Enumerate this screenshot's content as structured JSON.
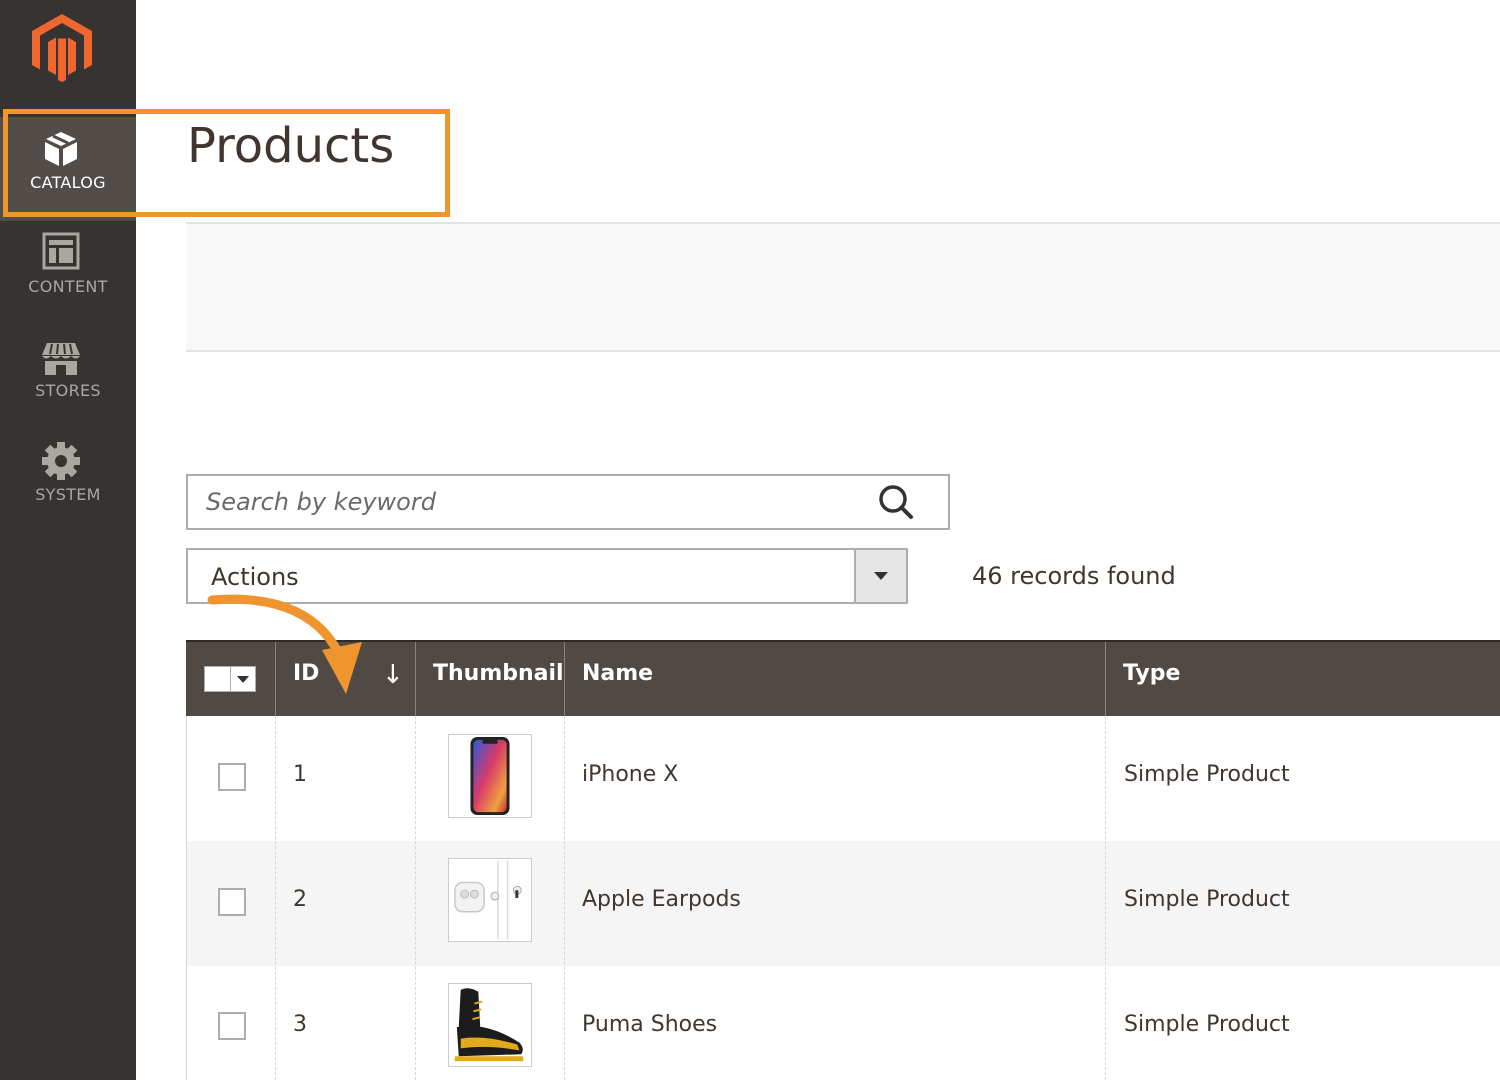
{
  "sidebar": {
    "logo": "magento-logo",
    "items": [
      {
        "label": "CATALOG",
        "icon": "box-icon",
        "active": true
      },
      {
        "label": "CONTENT",
        "icon": "layout-icon",
        "active": false
      },
      {
        "label": "STORES",
        "icon": "storefront-icon",
        "active": false
      },
      {
        "label": "SYSTEM",
        "icon": "gear-icon",
        "active": false
      }
    ]
  },
  "page": {
    "title": "Products"
  },
  "search": {
    "placeholder": "Search by keyword",
    "icon": "search-icon"
  },
  "actions": {
    "label": "Actions"
  },
  "records": {
    "text": "46 records found"
  },
  "grid": {
    "columns": [
      "ID",
      "Thumbnail",
      "Name",
      "Type"
    ],
    "sort_indicator": "↓",
    "rows": [
      {
        "id": "1",
        "name": "iPhone X",
        "type": "Simple Product",
        "thumbnail": "iphone-x-thumbnail"
      },
      {
        "id": "2",
        "name": "Apple Earpods",
        "type": "Simple Product",
        "thumbnail": "apple-earpods-thumbnail"
      },
      {
        "id": "3",
        "name": "Puma Shoes",
        "type": "Simple Product",
        "thumbnail": "puma-shoes-thumbnail"
      }
    ]
  },
  "colors": {
    "sidebar_bg": "#373330",
    "sidebar_active_bg": "#524d49",
    "header_bg": "#514943",
    "highlight": "#f0952d",
    "logo": "#ef672f"
  }
}
